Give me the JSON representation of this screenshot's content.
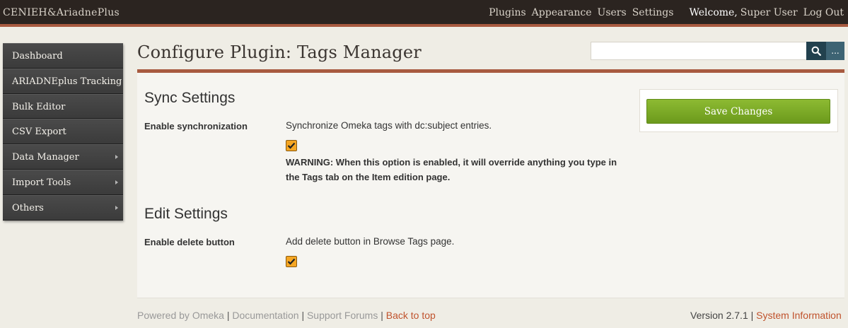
{
  "header": {
    "site_title": "CENIEH&AriadnePlus",
    "nav": [
      "Plugins",
      "Appearance",
      "Users",
      "Settings"
    ],
    "welcome": "Welcome,",
    "user": "Super User",
    "logout": "Log Out"
  },
  "sidebar": {
    "items": [
      {
        "label": "Dashboard",
        "has_submenu": false
      },
      {
        "label": "ARIADNEplus Tracking",
        "has_submenu": false
      },
      {
        "label": "Bulk Editor",
        "has_submenu": false
      },
      {
        "label": "CSV Export",
        "has_submenu": false
      },
      {
        "label": "Data Manager",
        "has_submenu": true
      },
      {
        "label": "Import Tools",
        "has_submenu": true
      },
      {
        "label": "Others",
        "has_submenu": true
      }
    ]
  },
  "page_title": "Configure Plugin: Tags Manager",
  "search": {
    "value": "",
    "placeholder": "",
    "advanced_label": "..."
  },
  "sync_settings": {
    "title": "Sync Settings",
    "field_label": "Enable synchronization",
    "description": "Synchronize Omeka tags with dc:subject entries.",
    "checked": true,
    "warning": "WARNING: When this option is enabled, it will override anything you type in the Tags tab on the Item edition page."
  },
  "edit_settings": {
    "title": "Edit Settings",
    "field_label": "Enable delete button",
    "description": "Add delete button in Browse Tags page.",
    "checked": true
  },
  "save_button": "Save Changes",
  "footer": {
    "powered_by": "Powered by Omeka",
    "documentation": "Documentation",
    "support": "Support Forums",
    "back_to_top": "Back to top",
    "version": "Version 2.7.1",
    "system_info": "System Information"
  },
  "colors": {
    "accent": "#a85a40",
    "topbar": "#2b2420",
    "save_green": "#7aaa24",
    "checkbox": "#f5a623",
    "link": "#c0532d"
  }
}
